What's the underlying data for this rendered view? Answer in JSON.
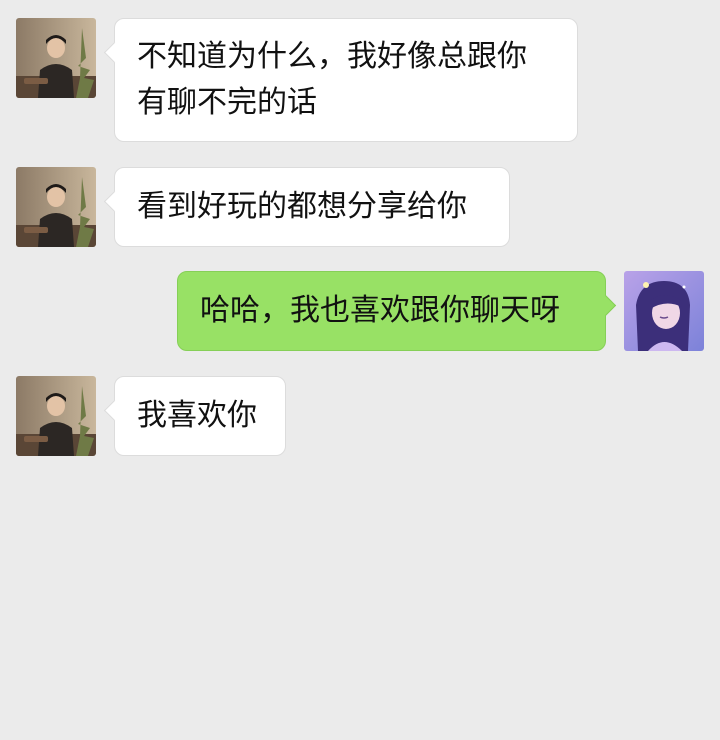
{
  "colors": {
    "background": "#ebebeb",
    "incoming_bubble": "#ffffff",
    "outgoing_bubble": "#98e165"
  },
  "messages": [
    {
      "side": "in",
      "avatar": "contact-avatar",
      "text": "不知道为什么，我好像总跟你\n有聊不完的话"
    },
    {
      "side": "in",
      "avatar": "contact-avatar",
      "text": "看到好玩的都想分享给你"
    },
    {
      "side": "out",
      "avatar": "user-avatar",
      "text": "哈哈，我也喜欢跟你聊天呀"
    },
    {
      "side": "in",
      "avatar": "contact-avatar",
      "text": "我喜欢你"
    }
  ]
}
